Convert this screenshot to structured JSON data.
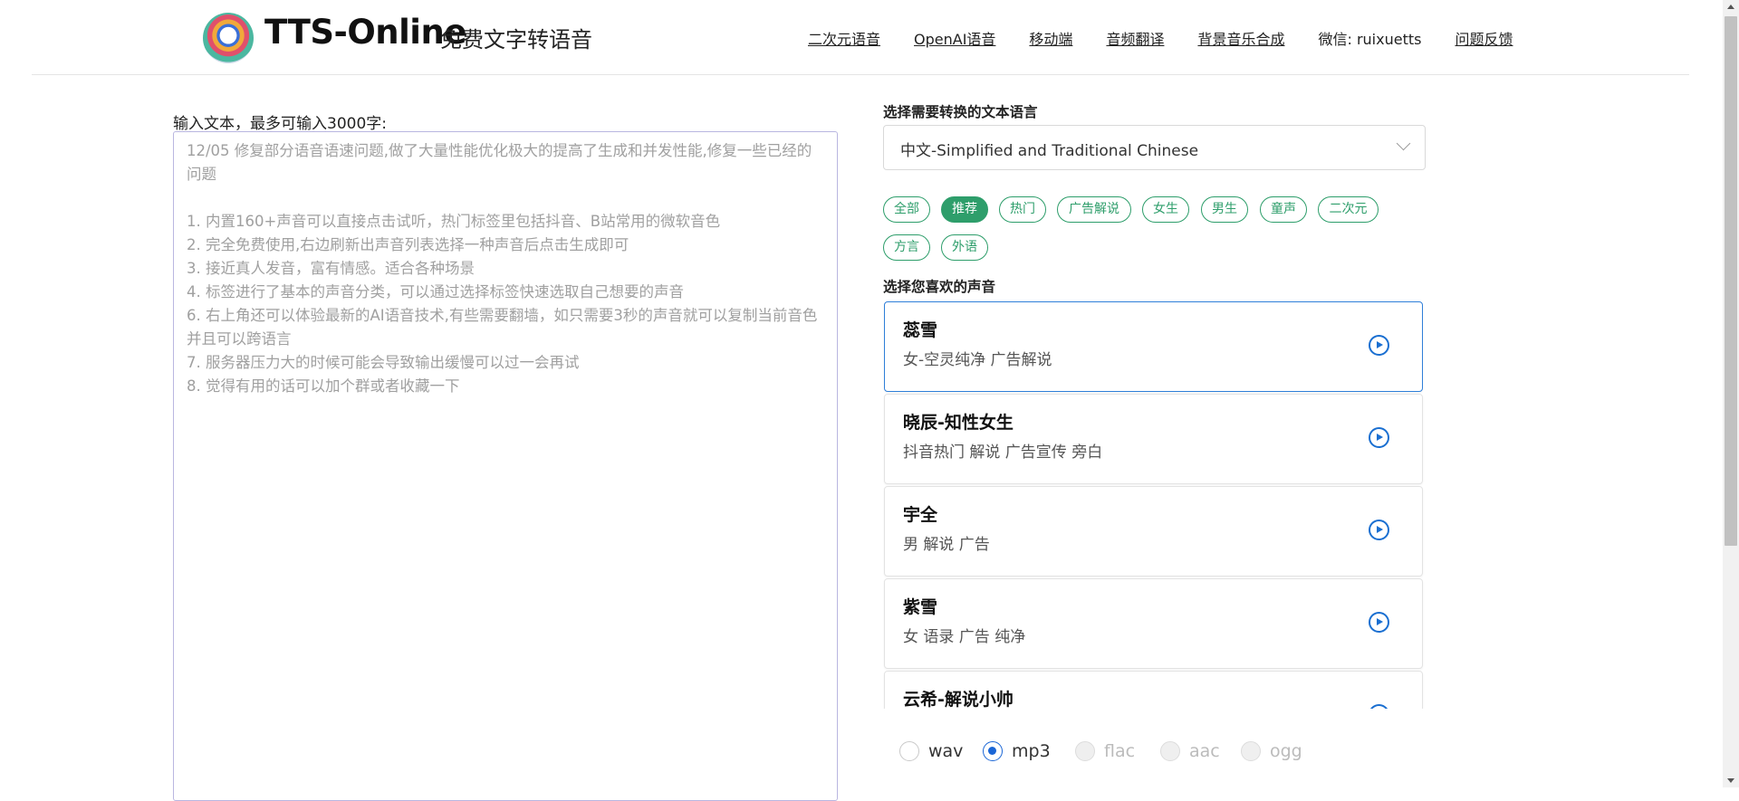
{
  "header": {
    "brand": "TTS-Online",
    "subtitle": "免费文字转语音",
    "nav": [
      "二次元语音",
      "OpenAI语音",
      "移动端",
      "音频翻译",
      "背景音乐合成"
    ],
    "wechat": "微信: ruixuetts",
    "feedback": "问题反馈"
  },
  "input": {
    "label": "输入文本，最多可输入3000字:",
    "placeholder": "12/05 修复部分语音语速问题,做了大量性能优化极大的提高了生成和并发性能,修复一些已经的问题\n\n1. 内置160+声音可以直接点击试听，热门标签里包括抖音、B站常用的微软音色\n2. 完全免费使用,右边刷新出声音列表选择一种声音后点击生成即可\n3. 接近真人发音，富有情感。适合各种场景\n4. 标签进行了基本的声音分类，可以通过选择标签快速选取自己想要的声音\n6. 右上角还可以体验最新的AI语音技术,有些需要翻墙，如只需要3秒的声音就可以复制当前音色并且可以跨语言\n7. 服务器压力大的时候可能会导致输出缓慢可以过一会再试\n8. 觉得有用的话可以加个群或者收藏一下"
  },
  "language": {
    "label": "选择需要转换的文本语言",
    "selected": "中文-Simplified and Traditional Chinese"
  },
  "tags": [
    "全部",
    "推荐",
    "热门",
    "广告解说",
    "女生",
    "男生",
    "童声",
    "二次元",
    "方言",
    "外语"
  ],
  "active_tag": "推荐",
  "voices": {
    "label": "选择您喜欢的声音",
    "items": [
      {
        "name": "蕊雪",
        "desc": "女-空灵纯净 广告解说"
      },
      {
        "name": "晓辰-知性女生",
        "desc": "抖音热门 解说 广告宣传 旁白"
      },
      {
        "name": "宇全",
        "desc": "男 解说 广告"
      },
      {
        "name": "紫雪",
        "desc": "女 语录 广告 纯净"
      },
      {
        "name": "云希-解说小帅",
        "desc": ""
      }
    ]
  },
  "formats": [
    {
      "label": "wav",
      "state": "unchecked"
    },
    {
      "label": "mp3",
      "state": "checked"
    },
    {
      "label": "flac",
      "state": "disabled"
    },
    {
      "label": "aac",
      "state": "disabled"
    },
    {
      "label": "ogg",
      "state": "disabled"
    }
  ],
  "colors": {
    "accent": "#2e9e6b",
    "selection": "#2f7fd9",
    "play": "#1a6fd1"
  }
}
